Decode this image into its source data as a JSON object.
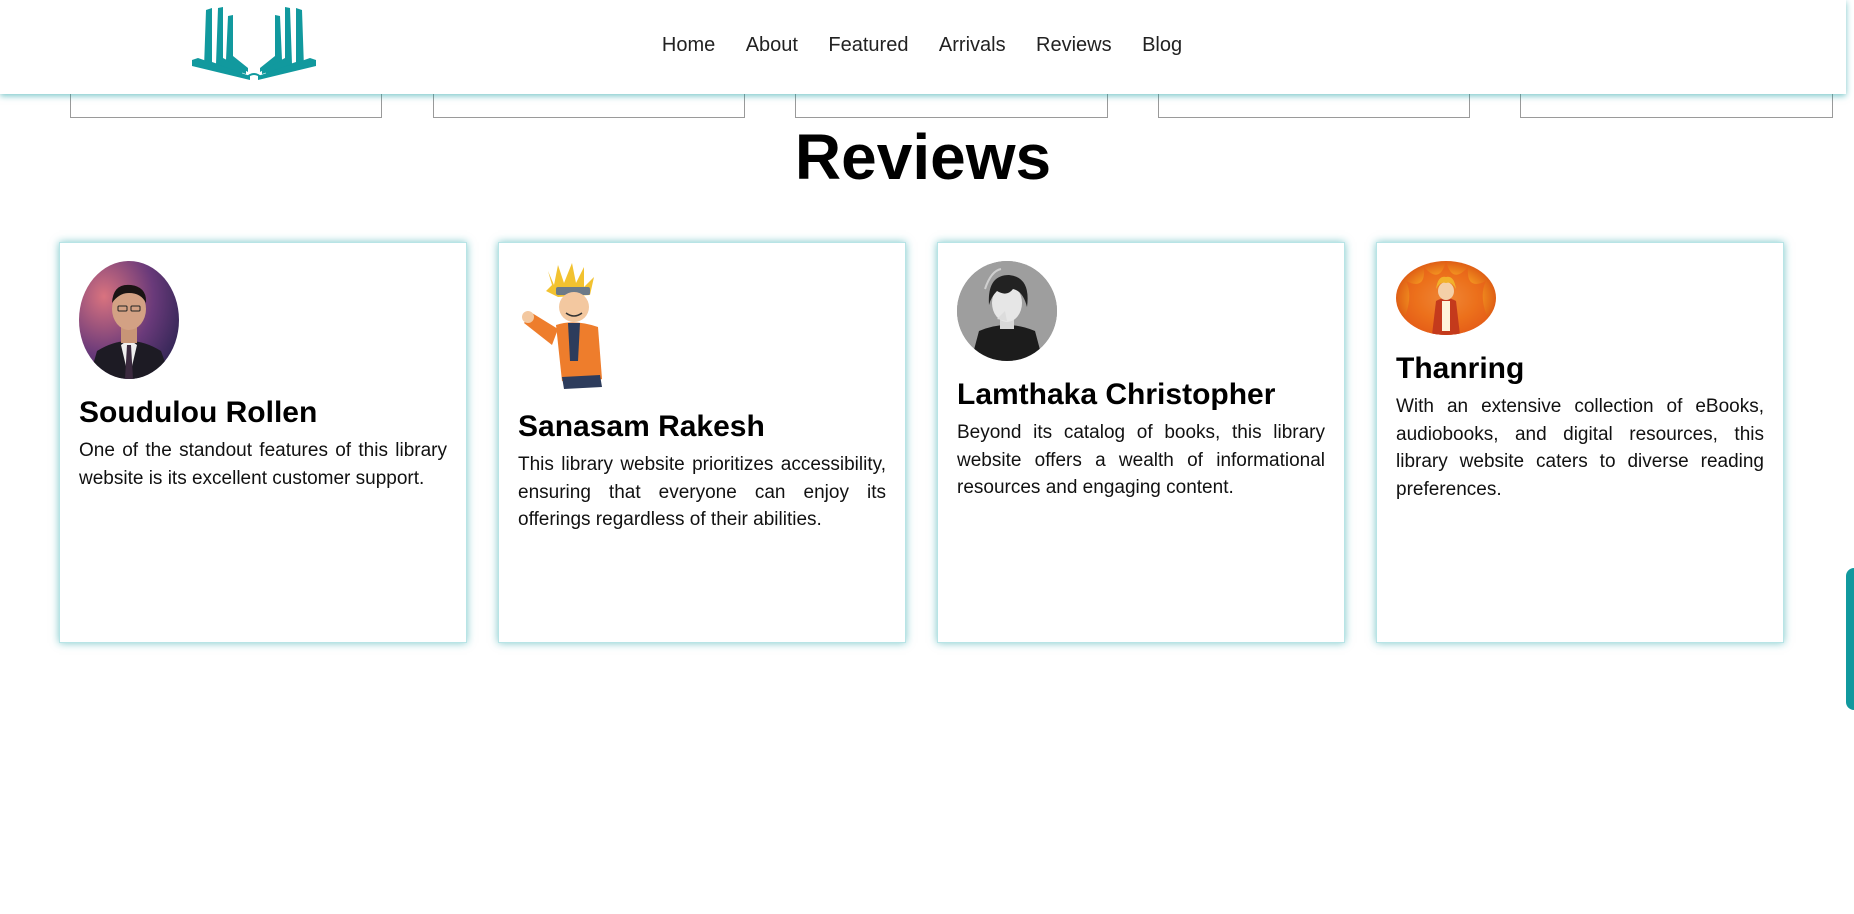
{
  "header": {
    "logo_icon": "open-book-icon",
    "nav": [
      "Home",
      "About",
      "Featured",
      "Arrivals",
      "Reviews",
      "Blog"
    ]
  },
  "reviews": {
    "title": "Reviews",
    "items": [
      {
        "name": "Soudulou Rollen",
        "text": "One of the standout features of this library website is its excellent customer support.",
        "avatar": "man-in-suit-avatar"
      },
      {
        "name": "Sanasam Rakesh",
        "text": "This library website prioritizes accessibility, ensuring that everyone can enjoy its offerings regardless of their abilities.",
        "avatar": "naruto-avatar"
      },
      {
        "name": "Lamthaka Christopher",
        "text": "Beyond its catalog of books, this library website offers a wealth of informational resources and engaging content.",
        "avatar": "anime-boy-avatar"
      },
      {
        "name": "Thanring",
        "text": "With an extensive collection of eBooks, audiobooks, and digital resources, this library website caters to diverse reading preferences.",
        "avatar": "fire-character-avatar"
      }
    ]
  },
  "colors": {
    "accent": "#11999e"
  }
}
